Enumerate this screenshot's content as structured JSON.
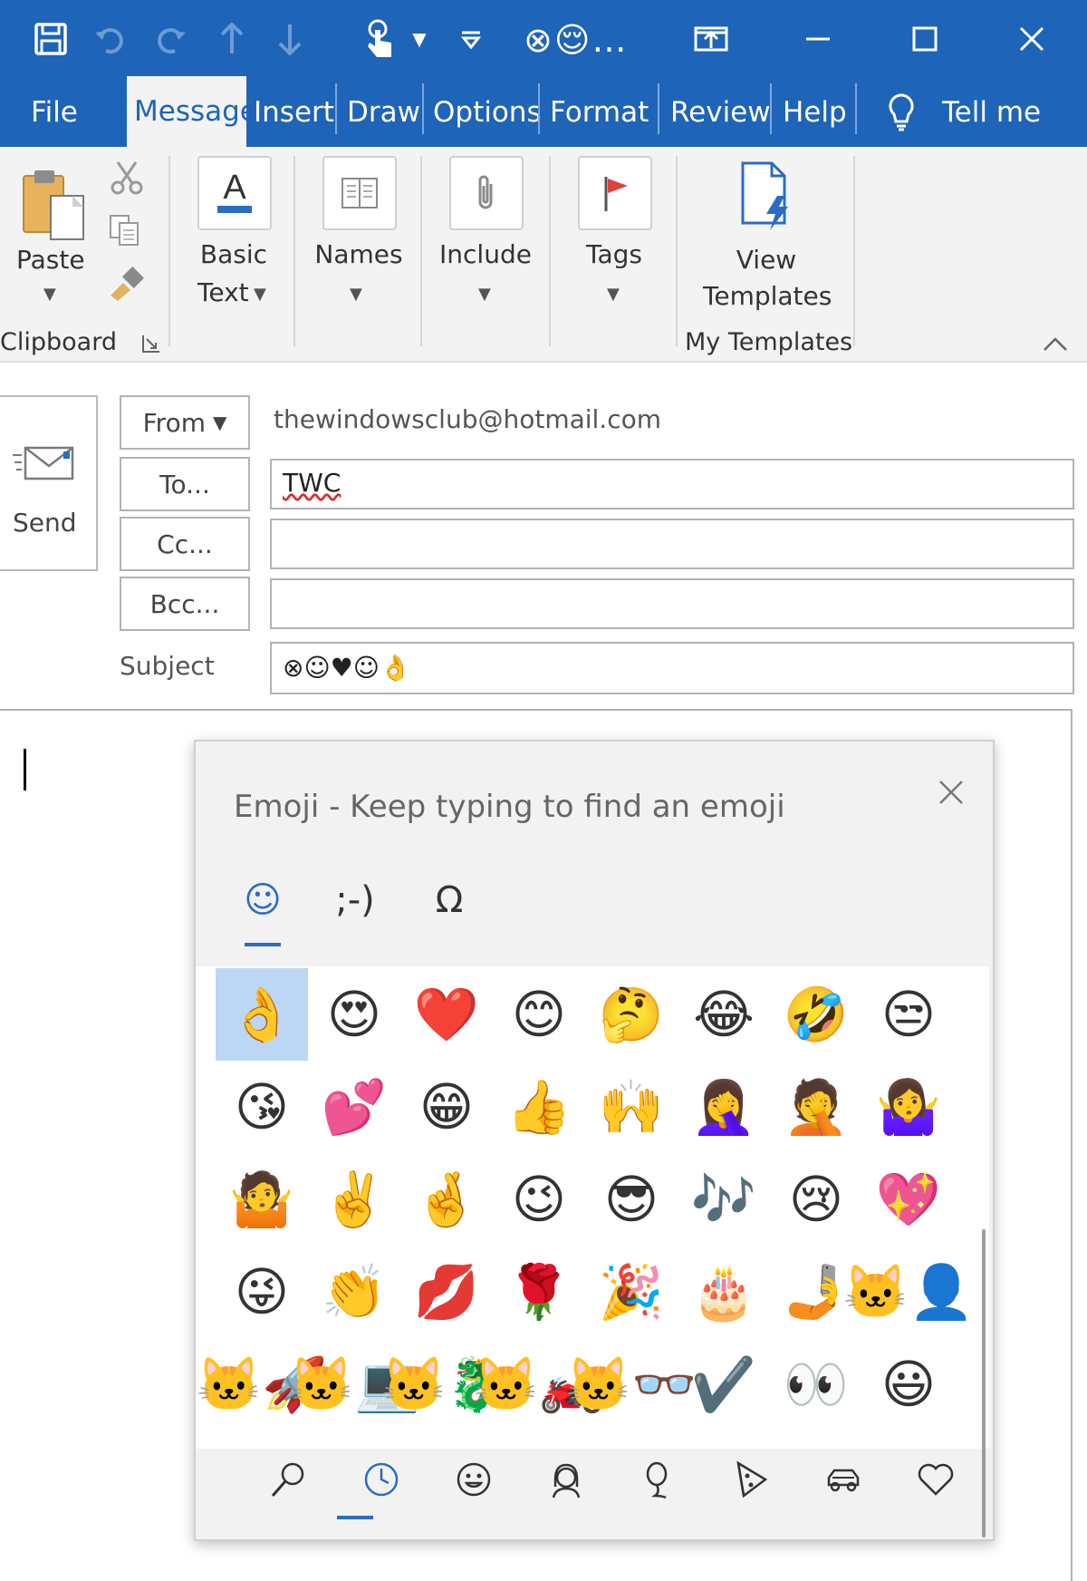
{
  "titlebar": {
    "title_emoji": "⊗😌…",
    "icons": [
      "save-icon",
      "undo-icon",
      "redo-icon",
      "up-arrow-icon",
      "down-arrow-icon",
      "touch-mode-icon",
      "dropdown-icon",
      "customize-icon",
      "restore-ribbon-icon",
      "minimize-icon",
      "maximize-icon",
      "close-icon"
    ]
  },
  "tabs": {
    "file": "File",
    "message": "Message",
    "insert": "Insert",
    "draw": "Draw",
    "options": "Options",
    "format": "Format",
    "review": "Review",
    "help": "Help",
    "tell_me": "Tell me"
  },
  "ribbon": {
    "paste": "Paste",
    "clipboard": "Clipboard",
    "basic": "Basic",
    "text": "Text",
    "names": "Names",
    "include": "Include",
    "tags": "Tags",
    "view": "View",
    "templates": "Templates",
    "my_templates": "My Templates",
    "caret": "▼"
  },
  "compose": {
    "send": "Send",
    "from_btn": "From",
    "from_value": "thewindowsclub@hotmail.com",
    "to_btn": "To...",
    "to_value": "TWC",
    "cc_btn": "Cc...",
    "cc_value": "",
    "bcc_btn": "Bcc...",
    "bcc_value": "",
    "subject_label": "Subject",
    "subject_value": "⊗☺♥☺👌"
  },
  "emoji_panel": {
    "title": "Emoji - Keep typing to find an emoji",
    "tabs": [
      "☺",
      ";-)",
      "Ω"
    ],
    "active_tab": 0,
    "selected_index": 0,
    "grid": [
      "👌",
      "😍",
      "❤️",
      "😊",
      "🤔",
      "😂",
      "🤣",
      "😒",
      "😘",
      "💕",
      "😁",
      "👍",
      "🙌",
      "🤦‍♀️",
      "🤦",
      "🤷‍♀️",
      "🤷",
      "✌️",
      "🤞",
      "😉",
      "😎",
      "🎶",
      "😢",
      "💖",
      "😜",
      "👏",
      "💋",
      "🌹",
      "🎉",
      "🎂",
      "🤳",
      "🐱‍👤",
      "🐱‍🚀",
      "🐱‍💻",
      "🐱‍🐉",
      "🐱‍🏍",
      "🐱‍👓",
      "✔️",
      "👀",
      "😃"
    ],
    "categories": [
      "search-icon",
      "recent-icon",
      "smiley-icon",
      "people-icon",
      "celebration-icon",
      "food-icon",
      "travel-icon",
      "heart-icon"
    ],
    "active_category": 1
  }
}
